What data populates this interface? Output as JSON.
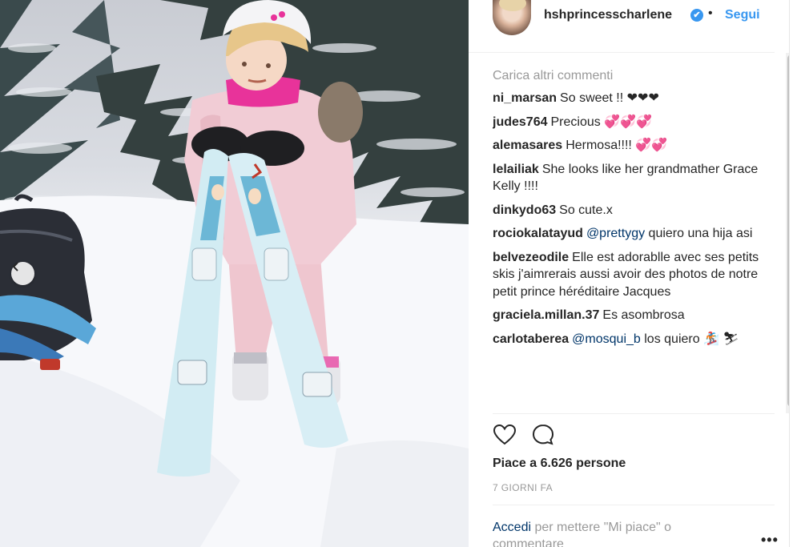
{
  "post": {
    "username": "hshprincesscharlene",
    "verified_badge": "✔",
    "separator": "•",
    "follow_label": "Segui",
    "load_more_label": "Carica altri commenti",
    "comments": [
      {
        "user": "ni_marsan",
        "parts": [
          {
            "text": "So sweet !! ❤❤❤"
          }
        ]
      },
      {
        "user": "judes764",
        "parts": [
          {
            "text": "Precious 💞💞💞"
          }
        ]
      },
      {
        "user": "alemasares",
        "parts": [
          {
            "text": "Hermosa!!!! 💞💞"
          }
        ]
      },
      {
        "user": "lelailiak",
        "parts": [
          {
            "text": "She looks like her grandmather Grace Kelly !!!!"
          }
        ]
      },
      {
        "user": "dinkydo63",
        "parts": [
          {
            "text": "So cute.x"
          }
        ]
      },
      {
        "user": "rociokalatayud",
        "parts": [
          {
            "text": "@prettygy",
            "mention": true
          },
          {
            "text": " quiero una hija asi"
          }
        ]
      },
      {
        "user": "belvezeodile",
        "parts": [
          {
            "text": "Elle est adorablle avec ses petits skis j'aimrerais aussi avoir des photos de notre petit prince héréditaire Jacques"
          }
        ]
      },
      {
        "user": "graciela.millan.37",
        "parts": [
          {
            "text": "Es asombrosa"
          }
        ]
      },
      {
        "user": "carlotaberea",
        "parts": [
          {
            "text": "@mosqui_b",
            "mention": true
          },
          {
            "text": " los quiero 🏂 ⛷"
          }
        ]
      }
    ],
    "likes_label": "Piace a 6.626 persone",
    "time_label": "7 GIORNI FA",
    "login_link": "Accedi",
    "login_rest": " per mettere \"Mi piace\" o commentare",
    "more_options": "•••"
  },
  "icons": {
    "like": "heart-icon",
    "comment": "comment-bubble-icon",
    "carousel": "chevron-left-icon"
  },
  "colors": {
    "link": "#3897f0",
    "mention": "#003569",
    "muted": "#999999",
    "text": "#262626"
  }
}
